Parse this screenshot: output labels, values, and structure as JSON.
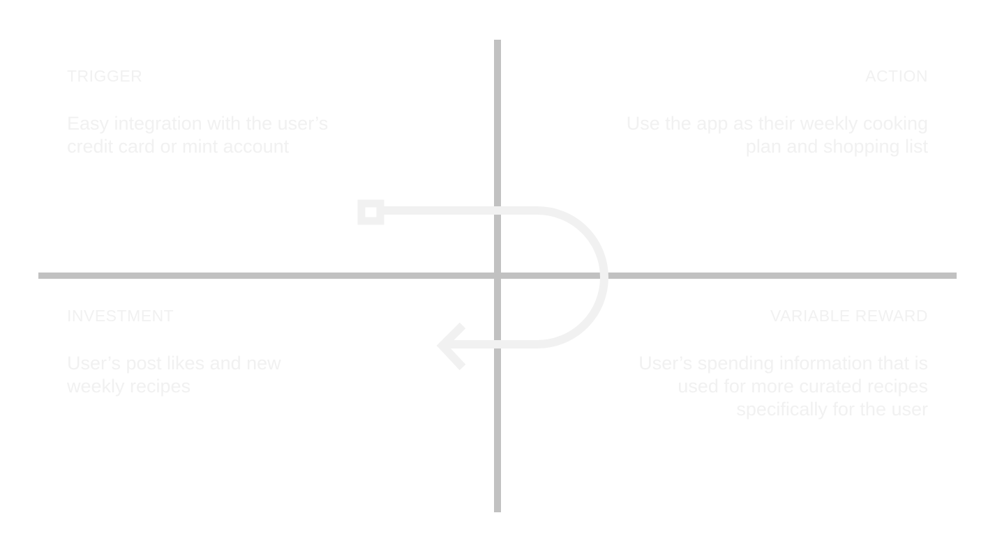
{
  "quadrants": {
    "trigger": {
      "heading": "TRIGGER",
      "text": "Easy integration with the user’s credit card or mint account"
    },
    "action": {
      "heading": "ACTION",
      "text": "Use the app as their weekly cooking plan and shopping list"
    },
    "investment": {
      "heading": "INVESTMENT",
      "text": "User’s post likes and new weekly recipes"
    },
    "variable_reward": {
      "heading": "VARIABLE REWARD",
      "text": "User’s spending information that is used for more curated recipes specifically for the user"
    }
  },
  "colors": {
    "axis": "#c1c1c1",
    "text": "#f1f1f1",
    "loop": "#f1f1f1",
    "background": "#ffffff"
  },
  "icons": {
    "loop_start": "square-node-icon",
    "loop_end": "arrow-left-icon"
  }
}
